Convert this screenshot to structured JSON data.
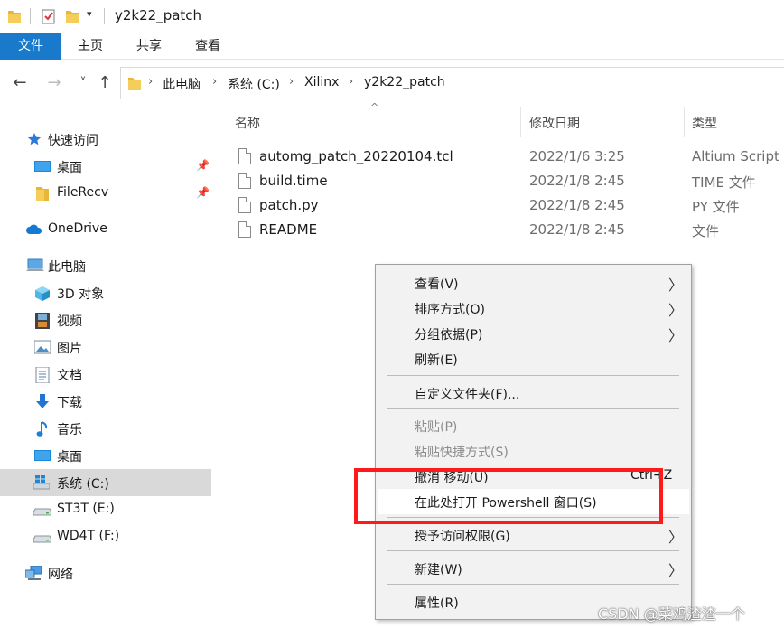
{
  "window": {
    "title": "y2k22_patch"
  },
  "ribbon": {
    "tabs": [
      "文件",
      "主页",
      "共享",
      "查看"
    ]
  },
  "nav": {
    "back": "←",
    "forward": "→",
    "recent": "˅",
    "up": "↑",
    "breadcrumb": [
      "此电脑",
      "系统 (C:)",
      "Xilinx",
      "y2k22_patch"
    ]
  },
  "sidebar": {
    "items": [
      {
        "label": "快速访问",
        "icon": "star-icon"
      },
      {
        "label": "桌面",
        "icon": "desktop-icon",
        "pinned": true
      },
      {
        "label": "FileRecv",
        "icon": "folder-icon",
        "pinned": true
      },
      {
        "label": "OneDrive",
        "icon": "cloud-icon"
      },
      {
        "label": "此电脑",
        "icon": "computer-icon"
      },
      {
        "label": "3D 对象",
        "icon": "cube-icon"
      },
      {
        "label": "视频",
        "icon": "film-icon"
      },
      {
        "label": "图片",
        "icon": "picture-icon"
      },
      {
        "label": "文档",
        "icon": "document-icon"
      },
      {
        "label": "下载",
        "icon": "download-icon"
      },
      {
        "label": "音乐",
        "icon": "music-icon"
      },
      {
        "label": "桌面",
        "icon": "desktop-icon"
      },
      {
        "label": "系统 (C:)",
        "icon": "windows-drive-icon",
        "selected": true
      },
      {
        "label": "ST3T (E:)",
        "icon": "drive-icon"
      },
      {
        "label": "WD4T (F:)",
        "icon": "drive-icon"
      },
      {
        "label": "网络",
        "icon": "network-icon"
      }
    ]
  },
  "filelist": {
    "columns": {
      "name": "名称",
      "modified": "修改日期",
      "type": "类型"
    },
    "rows": [
      {
        "name": "automg_patch_20220104.tcl",
        "modified": "2022/1/6 3:25",
        "type": "Altium Script D"
      },
      {
        "name": "build.time",
        "modified": "2022/1/8 2:45",
        "type": "TIME 文件"
      },
      {
        "name": "patch.py",
        "modified": "2022/1/8 2:45",
        "type": "PY 文件"
      },
      {
        "name": "README",
        "modified": "2022/1/8 2:45",
        "type": "文件"
      }
    ]
  },
  "context_menu": {
    "view": "查看(V)",
    "sort": "排序方式(O)",
    "group": "分组依据(P)",
    "refresh": "刷新(E)",
    "customize": "自定义文件夹(F)...",
    "paste": "粘贴(P)",
    "paste_shortcut": "粘贴快捷方式(S)",
    "undo_move": "撤消 移动(U)",
    "undo_shortcut": "Ctrl+Z",
    "powershell": "在此处打开 Powershell 窗口(S)",
    "grant_access": "授予访问权限(G)",
    "new": "新建(W)",
    "properties": "属性(R)"
  },
  "colors": {
    "accent": "#1979ca",
    "highlight_box": "#ff1a1a",
    "selected_bg": "#d9d9d9"
  },
  "watermark": "CSDN @菜鸡渣渣一个"
}
